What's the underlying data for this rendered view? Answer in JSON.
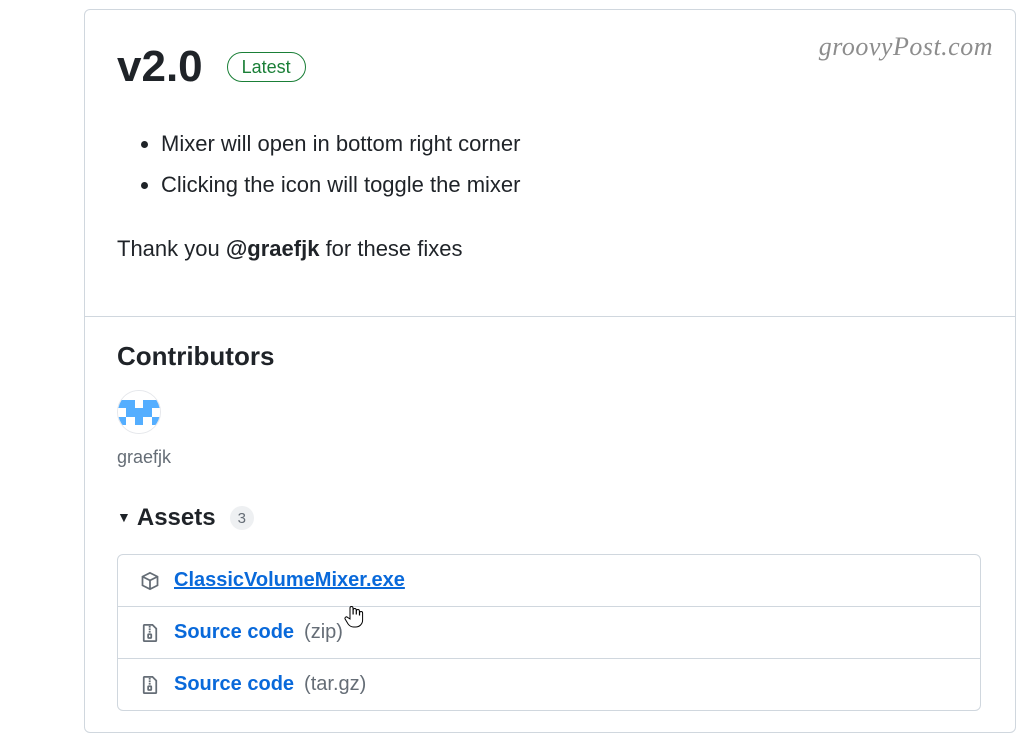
{
  "watermark": "groovyPost.com",
  "release": {
    "title": "v2.0",
    "badge": "Latest",
    "notes": [
      "Mixer will open in bottom right corner",
      "Clicking the icon will toggle the mixer"
    ],
    "thank_prefix": "Thank you ",
    "thank_mention": "@graefjk",
    "thank_suffix": " for these fixes"
  },
  "contributors": {
    "heading": "Contributors",
    "items": [
      {
        "name": "graefjk"
      }
    ]
  },
  "assets": {
    "heading": "Assets",
    "count": "3",
    "items": [
      {
        "name": "ClassicVolumeMixer.exe",
        "format": "",
        "icon": "package",
        "highlighted": true
      },
      {
        "name": "Source code",
        "format": "(zip)",
        "icon": "zip",
        "highlighted": false
      },
      {
        "name": "Source code",
        "format": "(tar.gz)",
        "icon": "zip",
        "highlighted": false
      }
    ]
  }
}
